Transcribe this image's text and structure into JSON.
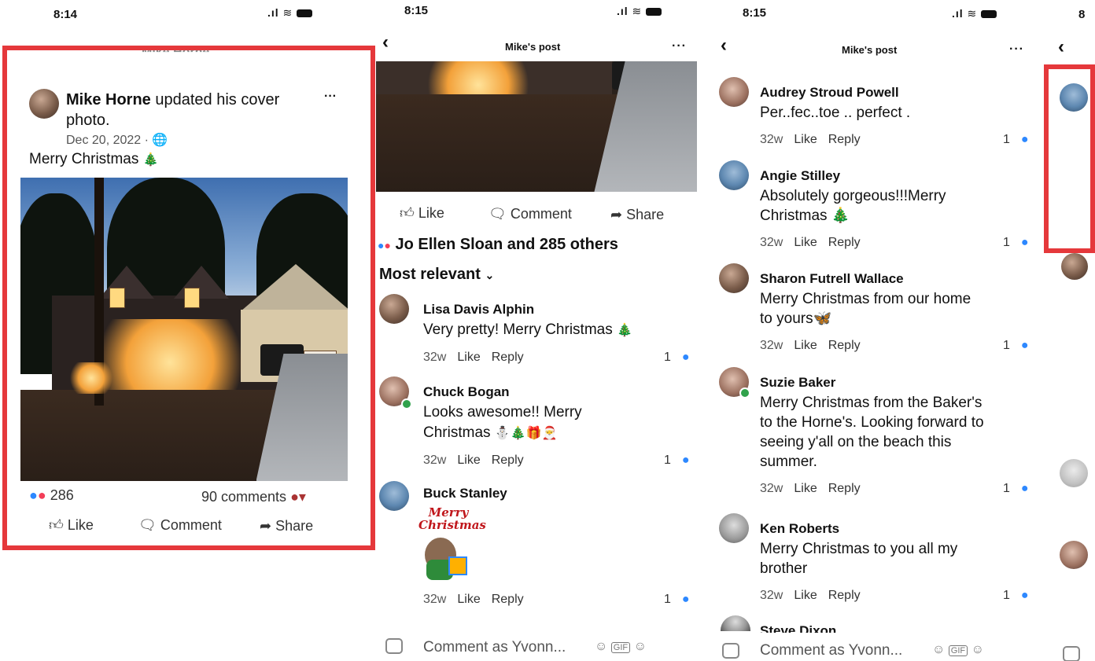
{
  "panel1": {
    "time": "8:14",
    "header_title": "Mike Horne",
    "post": {
      "author": "Mike Horne",
      "action": " updated his cover",
      "action_line2": "photo.",
      "date": "Dec 20, 2022 · ",
      "caption": "Merry Christmas",
      "caption_emoji": "🎄",
      "reactions_count": "286",
      "comments_count": "90 comments",
      "more": "···"
    },
    "actions": {
      "like": "Like",
      "comment": "Comment",
      "share": "Share"
    }
  },
  "panel2": {
    "time": "8:15",
    "header_title": "Mike's post",
    "actions": {
      "like": "Like",
      "comment": "Comment",
      "share": "Share"
    },
    "reactors": "Jo Ellen Sloan and 285 others",
    "sort": "Most relevant",
    "comments": [
      {
        "name": "Lisa Davis Alphin",
        "text": "Very pretty! Merry Christmas",
        "emoji": "🎄",
        "time": "32w",
        "like": "Like",
        "reply": "Reply",
        "count": "1"
      },
      {
        "name": "Chuck Bogan",
        "text": "Looks awesome!!  Merry",
        "text2": "Christmas",
        "emoji": "⛄🎄🎁🎅",
        "time": "32w",
        "like": "Like",
        "reply": "Reply",
        "count": "1"
      },
      {
        "name": "Buck Stanley",
        "sticker_text": "Merry Christmas",
        "time": "32w",
        "like": "Like",
        "reply": "Reply",
        "count": "1"
      }
    ],
    "composer": "Comment as Yvonn...",
    "composer_icons": [
      "camera-icon",
      "sticker-icon",
      "gif-icon",
      "emoji-icon"
    ]
  },
  "panel3": {
    "time": "8:15",
    "header_title": "Mike's post",
    "comments": [
      {
        "name": "Audrey Stroud Powell",
        "lines": [
          "Per..fec..toe .. perfect ."
        ],
        "time": "32w",
        "like": "Like",
        "reply": "Reply",
        "count": "1"
      },
      {
        "name": "Angie Stilley",
        "lines": [
          "Absolutely gorgeous!!!Merry",
          "Christmas 🎄"
        ],
        "time": "32w",
        "like": "Like",
        "reply": "Reply",
        "count": "1"
      },
      {
        "name": "Sharon Futrell Wallace",
        "lines": [
          "Merry Christmas from our home",
          "to yours🦋"
        ],
        "time": "32w",
        "like": "Like",
        "reply": "Reply",
        "count": "1"
      },
      {
        "name": "Suzie Baker",
        "lines": [
          "Merry Christmas from the Baker's",
          "to the Horne's. Looking forward to",
          "seeing y'all on the beach this",
          "summer."
        ],
        "time": "32w",
        "like": "Like",
        "reply": "Reply",
        "count": "1"
      },
      {
        "name": "Ken Roberts",
        "lines": [
          "Merry Christmas to you all my",
          "brother"
        ],
        "time": "32w",
        "like": "Like",
        "reply": "Reply",
        "count": "1"
      }
    ],
    "partial_name": "Steve Dixon",
    "composer": "Comment as Yvonn..."
  },
  "panel4": {
    "time": "8"
  },
  "colors": {
    "highlight": "#e5383b",
    "like_blue": "#2d88ff",
    "love_red": "#f33e58",
    "online": "#31a24c"
  }
}
